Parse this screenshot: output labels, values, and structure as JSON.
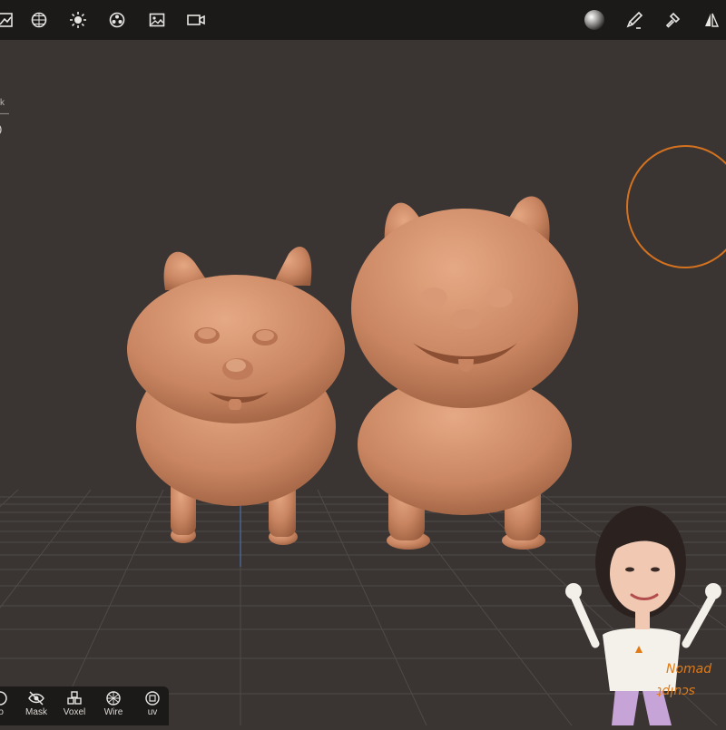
{
  "toolbar": {
    "left_icons": [
      "scene-icon",
      "grid-sphere-icon",
      "sun-icon",
      "material-icon",
      "image-icon",
      "camera-icon"
    ],
    "right_icons": [
      "matcap-sphere-icon",
      "paint-brush-icon",
      "hammer-icon",
      "symmetry-icon"
    ]
  },
  "hud": {
    "line1": "k",
    "line2": "—"
  },
  "bottom_bar": {
    "items": [
      {
        "label": "lo",
        "icon": "solo-icon"
      },
      {
        "label": "Mask",
        "icon": "mask-eye-icon"
      },
      {
        "label": "Voxel",
        "icon": "voxel-icon"
      },
      {
        "label": "Wire",
        "icon": "wireframe-icon"
      },
      {
        "label": "uv",
        "icon": "uv-icon"
      }
    ]
  },
  "sticker": {
    "line1": "Nomad",
    "line2": "sculpt"
  },
  "colors": {
    "background": "#3a3533",
    "toolbar": "#1c1a19",
    "clay": "#c98561",
    "brush_ring": "#d4721f"
  }
}
